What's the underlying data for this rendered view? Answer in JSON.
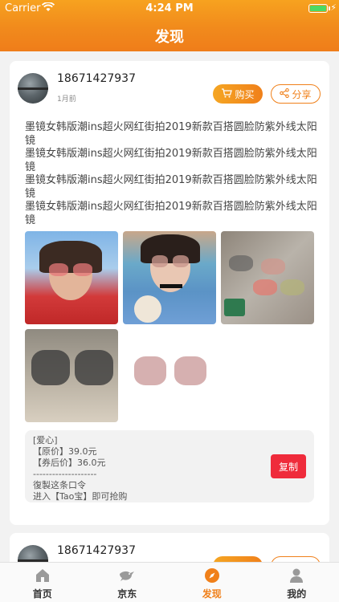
{
  "status_bar": {
    "carrier": "Carrier",
    "time": "4:24 PM"
  },
  "header": {
    "title": "发现"
  },
  "posts": [
    {
      "username": "18671427937",
      "time_ago": "1月前",
      "buy_label": "购买",
      "share_label": "分享",
      "content": "墨镜女韩版潮ins超火网红街拍2019新款百搭圆脸防紫外线太阳镜\n墨镜女韩版潮ins超火网红街拍2019新款百搭圆脸防紫外线太阳镜\n墨镜女韩版潮ins超火网红街拍2019新款百搭圆脸防紫外线太阳镜\n墨镜女韩版潮ins超火网红街拍2019新款百搭圆脸防紫外线太阳镜",
      "coupon_text": "[爱心]\n【原价】39.0元\n【券后价】36.0元\n--------------------\n復製这条口令\n进入【Tao宝】即可抢购",
      "copy_label": "复制"
    },
    {
      "username": "18671427937"
    }
  ],
  "tabs": [
    {
      "label": "首页",
      "icon": "home-icon"
    },
    {
      "label": "京东",
      "icon": "bird-icon"
    },
    {
      "label": "发现",
      "icon": "compass-icon",
      "active": true
    },
    {
      "label": "我的",
      "icon": "user-icon"
    }
  ],
  "colors": {
    "accent": "#f0801a",
    "copy_button": "#ef2b3b",
    "battery": "#4cd964"
  }
}
